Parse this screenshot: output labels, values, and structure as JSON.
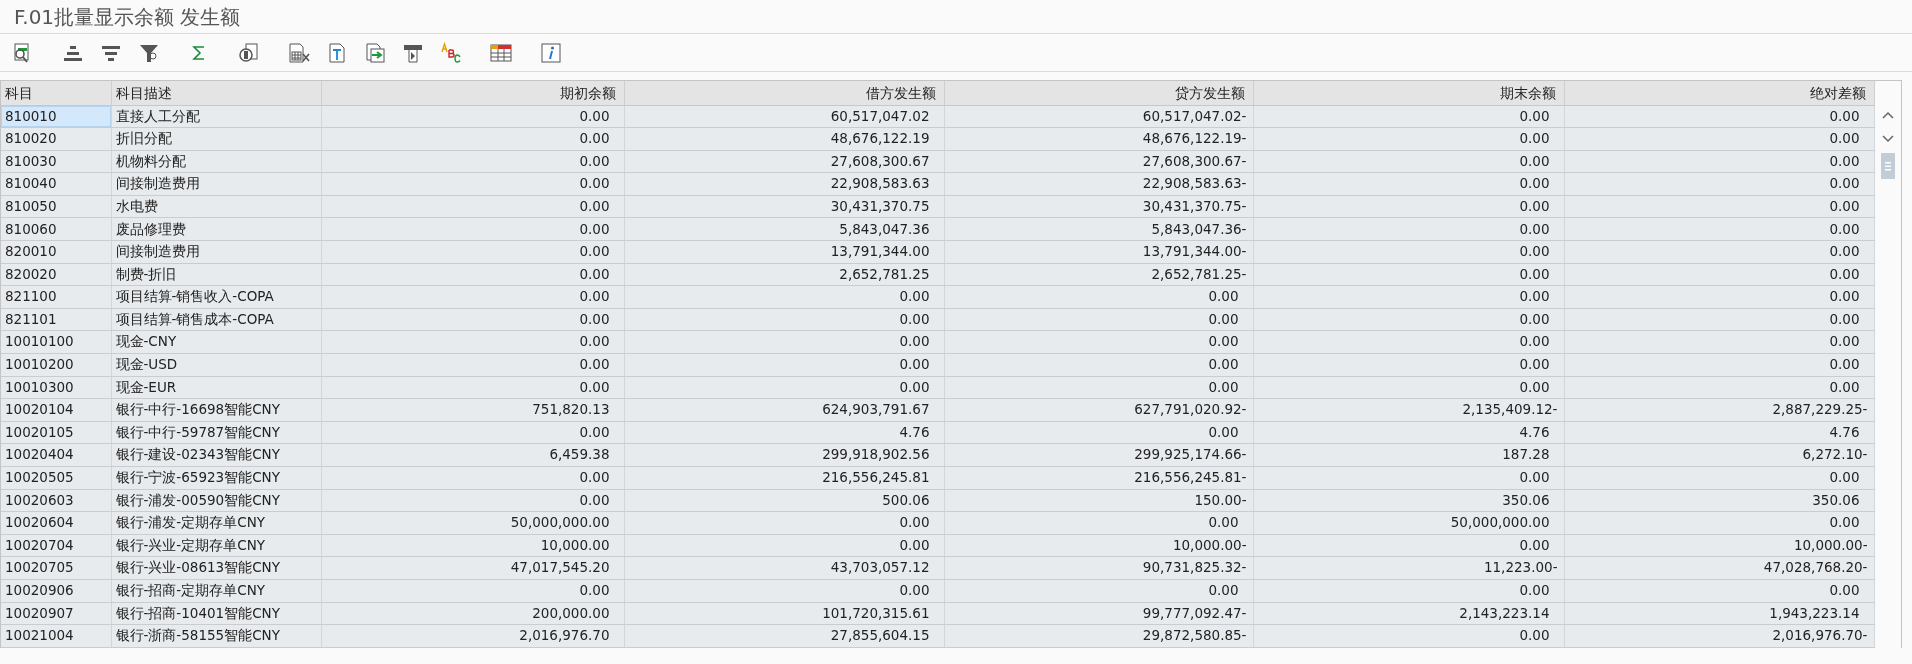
{
  "window": {
    "title": "F.01批量显示余额 发生额"
  },
  "table": {
    "columns": [
      "科目",
      "科目描述",
      "期初余额",
      "借方发生额",
      "贷方发生额",
      "期末余额",
      "绝对差额"
    ],
    "rows": [
      {
        "selected": true,
        "cells": [
          "810010",
          "直接人工分配",
          "0.00",
          "60,517,047.02",
          "60,517,047.02-",
          "0.00",
          "0.00"
        ]
      },
      {
        "selected": false,
        "cells": [
          "810020",
          "折旧分配",
          "0.00",
          "48,676,122.19",
          "48,676,122.19-",
          "0.00",
          "0.00"
        ]
      },
      {
        "selected": false,
        "cells": [
          "810030",
          "机物料分配",
          "0.00",
          "27,608,300.67",
          "27,608,300.67-",
          "0.00",
          "0.00"
        ]
      },
      {
        "selected": false,
        "cells": [
          "810040",
          "间接制造费用",
          "0.00",
          "22,908,583.63",
          "22,908,583.63-",
          "0.00",
          "0.00"
        ]
      },
      {
        "selected": false,
        "cells": [
          "810050",
          "水电费",
          "0.00",
          "30,431,370.75",
          "30,431,370.75-",
          "0.00",
          "0.00"
        ]
      },
      {
        "selected": false,
        "cells": [
          "810060",
          "废品修理费",
          "0.00",
          "5,843,047.36",
          "5,843,047.36-",
          "0.00",
          "0.00"
        ]
      },
      {
        "selected": false,
        "cells": [
          "820010",
          "间接制造费用",
          "0.00",
          "13,791,344.00",
          "13,791,344.00-",
          "0.00",
          "0.00"
        ]
      },
      {
        "selected": false,
        "cells": [
          "820020",
          "制费-折旧",
          "0.00",
          "2,652,781.25",
          "2,652,781.25-",
          "0.00",
          "0.00"
        ]
      },
      {
        "selected": false,
        "cells": [
          "821100",
          "项目结算-销售收入-COPA",
          "0.00",
          "0.00",
          "0.00",
          "0.00",
          "0.00"
        ]
      },
      {
        "selected": false,
        "cells": [
          "821101",
          "项目结算-销售成本-COPA",
          "0.00",
          "0.00",
          "0.00",
          "0.00",
          "0.00"
        ]
      },
      {
        "selected": false,
        "cells": [
          "10010100",
          "现金-CNY",
          "0.00",
          "0.00",
          "0.00",
          "0.00",
          "0.00"
        ]
      },
      {
        "selected": false,
        "cells": [
          "10010200",
          "现金-USD",
          "0.00",
          "0.00",
          "0.00",
          "0.00",
          "0.00"
        ]
      },
      {
        "selected": false,
        "cells": [
          "10010300",
          "现金-EUR",
          "0.00",
          "0.00",
          "0.00",
          "0.00",
          "0.00"
        ]
      },
      {
        "selected": false,
        "cells": [
          "10020104",
          "银行-中行-16698智能CNY",
          "751,820.13",
          "624,903,791.67",
          "627,791,020.92-",
          "2,135,409.12-",
          "2,887,229.25-"
        ]
      },
      {
        "selected": false,
        "cells": [
          "10020105",
          "银行-中行-59787智能CNY",
          "0.00",
          "4.76",
          "0.00",
          "4.76",
          "4.76"
        ]
      },
      {
        "selected": false,
        "cells": [
          "10020404",
          "银行-建设-02343智能CNY",
          "6,459.38",
          "299,918,902.56",
          "299,925,174.66-",
          "187.28",
          "6,272.10-"
        ]
      },
      {
        "selected": false,
        "cells": [
          "10020505",
          "银行-宁波-65923智能CNY",
          "0.00",
          "216,556,245.81",
          "216,556,245.81-",
          "0.00",
          "0.00"
        ]
      },
      {
        "selected": false,
        "cells": [
          "10020603",
          "银行-浦发-00590智能CNY",
          "0.00",
          "500.06",
          "150.00-",
          "350.06",
          "350.06"
        ]
      },
      {
        "selected": false,
        "cells": [
          "10020604",
          "银行-浦发-定期存单CNY",
          "50,000,000.00",
          "0.00",
          "0.00",
          "50,000,000.00",
          "0.00"
        ]
      },
      {
        "selected": false,
        "cells": [
          "10020704",
          "银行-兴业-定期存单CNY",
          "10,000.00",
          "0.00",
          "10,000.00-",
          "0.00",
          "10,000.00-"
        ]
      },
      {
        "selected": false,
        "cells": [
          "10020705",
          "银行-兴业-08613智能CNY",
          "47,017,545.20",
          "43,703,057.12",
          "90,731,825.32-",
          "11,223.00-",
          "47,028,768.20-"
        ]
      },
      {
        "selected": false,
        "cells": [
          "10020906",
          "银行-招商-定期存单CNY",
          "0.00",
          "0.00",
          "0.00",
          "0.00",
          "0.00"
        ]
      },
      {
        "selected": false,
        "cells": [
          "10020907",
          "银行-招商-10401智能CNY",
          "200,000.00",
          "101,720,315.61",
          "99,777,092.47-",
          "2,143,223.14",
          "1,943,223.14"
        ]
      },
      {
        "selected": false,
        "cells": [
          "10021004",
          "银行-浙商-58155智能CNY",
          "2,016,976.70",
          "27,855,604.15",
          "29,872,580.85-",
          "0.00",
          "2,016,976.70-"
        ]
      }
    ]
  }
}
